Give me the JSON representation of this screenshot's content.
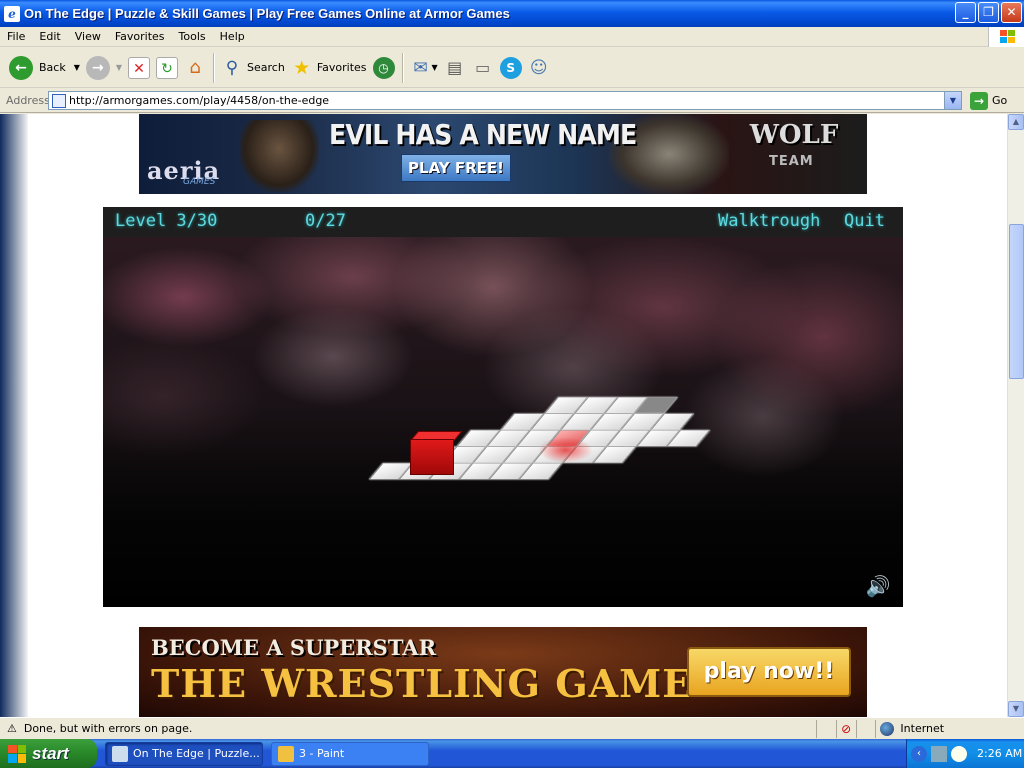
{
  "window": {
    "title": "On The Edge | Puzzle & Skill Games | Play Free Games Online at Armor Games",
    "buttons": {
      "minimize": "_",
      "maximize": "❐",
      "close": "✕"
    }
  },
  "menubar": {
    "items": [
      "File",
      "Edit",
      "View",
      "Favorites",
      "Tools",
      "Help"
    ]
  },
  "toolbar": {
    "back_label": "Back",
    "search_label": "Search",
    "favorites_label": "Favorites"
  },
  "address": {
    "label": "Address",
    "url": "http://armorgames.com/play/4458/on-the-edge",
    "go_label": "Go"
  },
  "banner_top": {
    "headline": "EVIL HAS A NEW NAME",
    "button": "PLAY FREE!",
    "brand": "aeria",
    "brand_sub": "GAMES",
    "game_logo": "WOLF",
    "game_logo_sub": "TEAM"
  },
  "game": {
    "level": "Level 3/30",
    "moves": "0/27",
    "walkthrough": "Walktrough",
    "quit": "Quit",
    "sound_icon": "speaker-icon"
  },
  "banner_bottom": {
    "line1": "BECOME A SUPERSTAR",
    "line2": "THE WRESTLING GAME",
    "button": "play now!!"
  },
  "statusbar": {
    "text": "Done, but with errors on page.",
    "zone": "Internet"
  },
  "taskbar": {
    "start": "start",
    "tasks": [
      {
        "label": "On The Edge | Puzzle...",
        "active": true
      },
      {
        "label": "3 - Paint",
        "active": false
      }
    ],
    "clock": "2:26 AM"
  },
  "colors": {
    "hud_text": "#5fd8e0",
    "xp_blue": "#0a5be8",
    "cube_red": "#e01a1a"
  }
}
